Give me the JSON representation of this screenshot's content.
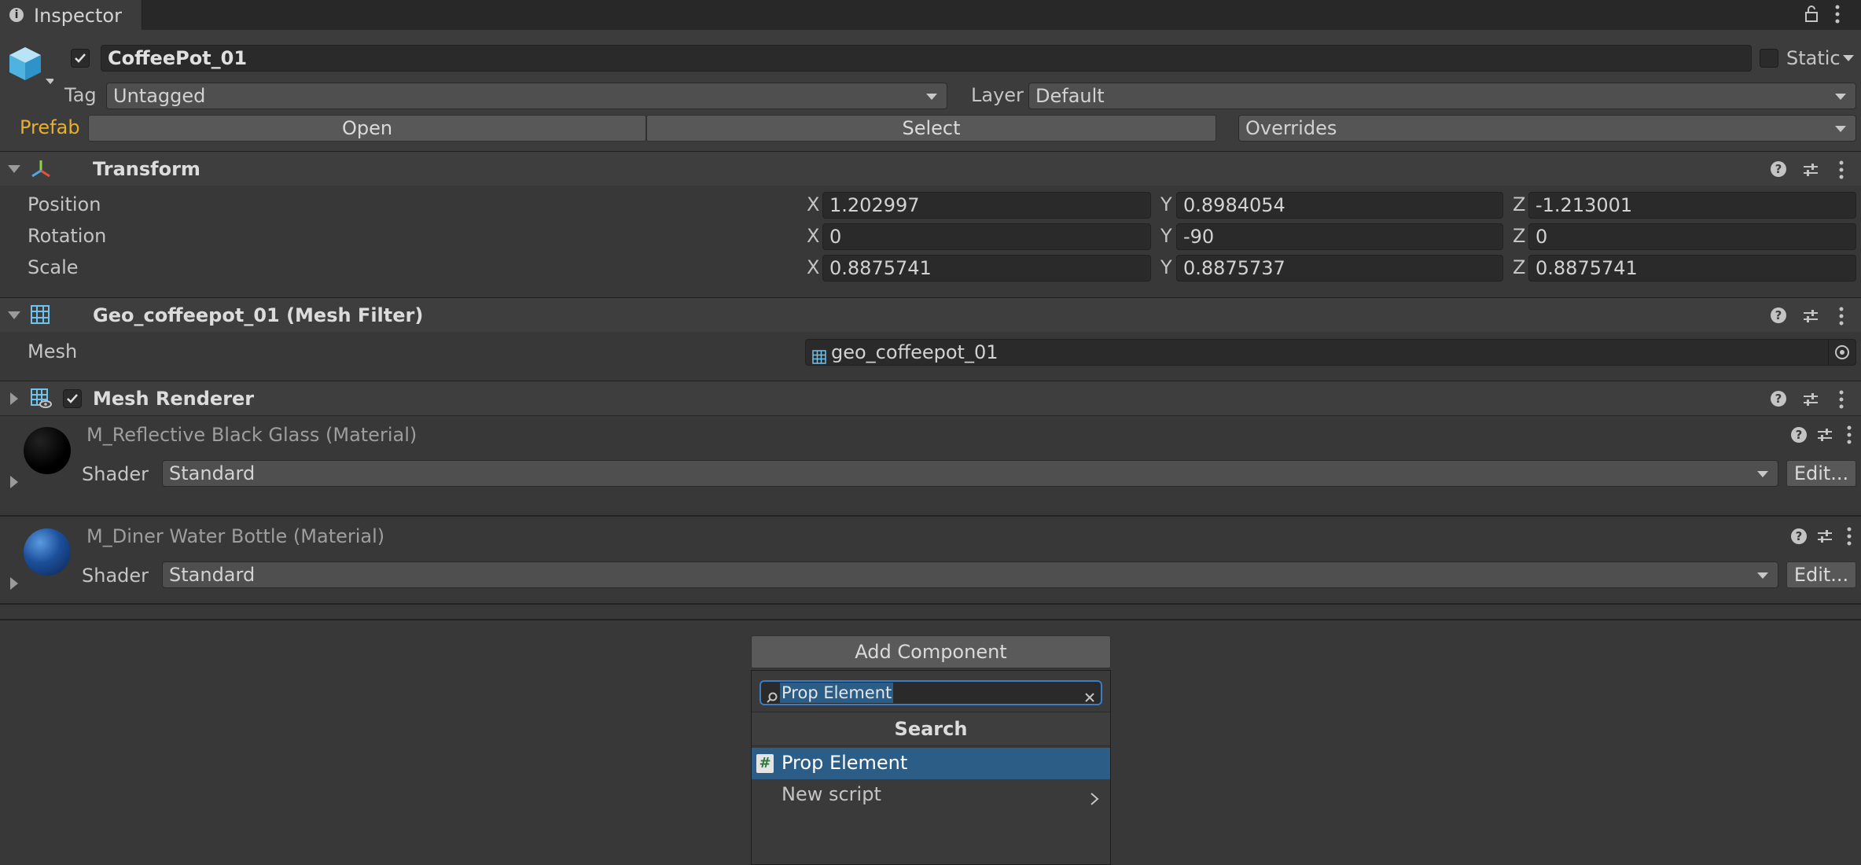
{
  "tab": {
    "title": "Inspector"
  },
  "object": {
    "name": "CoffeePot_01",
    "static_label": "Static",
    "tag_label": "Tag",
    "tag_value": "Untagged",
    "layer_label": "Layer",
    "layer_value": "Default",
    "prefab_label": "Prefab",
    "open_label": "Open",
    "select_label": "Select",
    "overrides_label": "Overrides"
  },
  "transform": {
    "title": "Transform",
    "rows": [
      {
        "label": "Position",
        "x": "1.202997",
        "y": "0.8984054",
        "z": "-1.213001"
      },
      {
        "label": "Rotation",
        "x": "0",
        "y": "-90",
        "z": "0"
      },
      {
        "label": "Scale",
        "x": "0.8875741",
        "y": "0.8875737",
        "z": "0.8875741"
      }
    ],
    "axis": {
      "x": "X",
      "y": "Y",
      "z": "Z"
    }
  },
  "mesh_filter": {
    "title": "Geo_coffeepot_01 (Mesh Filter)",
    "mesh_label": "Mesh",
    "mesh_value": "geo_coffeepot_01"
  },
  "mesh_renderer": {
    "title": "Mesh Renderer"
  },
  "materials": [
    {
      "name": "M_Reflective Black Glass (Material)",
      "shader_label": "Shader",
      "shader_value": "Standard",
      "edit_label": "Edit..."
    },
    {
      "name": "M_Diner Water Bottle (Material)",
      "shader_label": "Shader",
      "shader_value": "Standard",
      "edit_label": "Edit..."
    }
  ],
  "add_component": {
    "button_label": "Add Component",
    "search_value": "Prop Element",
    "section_title": "Search",
    "items": [
      {
        "label": "Prop Element",
        "selected": true
      },
      {
        "label": "New script",
        "selected": false
      }
    ]
  },
  "colors": {
    "background": "#383838",
    "prefab_accent": "#e8b02a",
    "selection": "#2c5d87",
    "text": "#c4c4c4"
  },
  "icons": [
    "info-icon",
    "lock-icon",
    "menu-dots-icon",
    "cube-icon",
    "transform-icon",
    "mesh-filter-icon",
    "mesh-renderer-icon",
    "help-icon",
    "presets-icon",
    "object-picker-icon",
    "search-icon",
    "clear-icon",
    "script-icon",
    "chevron-right-icon"
  ]
}
